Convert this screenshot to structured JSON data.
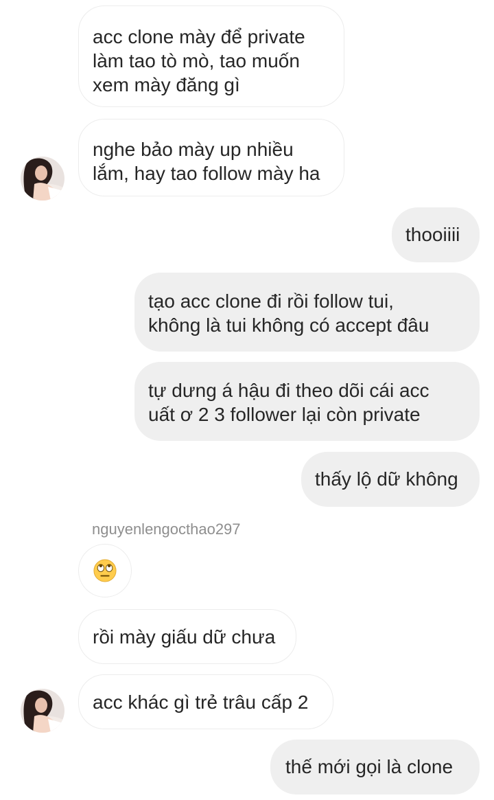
{
  "conversation": {
    "messages": [
      {
        "text": "acc clone mày để private\nlàm tao tò mò, tao muốn\nxem mày đăng gì"
      },
      {
        "text": "nghe bảo mày up nhiều\nlắm, hay tao follow mày ha"
      },
      {
        "text": "thooiiii"
      },
      {
        "text": "tạo acc clone đi rồi follow tui,\nkhông là tui không có accept đâu"
      },
      {
        "text": "tự dưng á hậu đi theo dõi cái acc\nuất ơ 2 3 follower lại còn private"
      },
      {
        "text": "thấy lộ dữ không"
      },
      {
        "text": "rồi mày giấu dữ chưa"
      },
      {
        "text": "acc khác gì trẻ trâu cấp 2"
      },
      {
        "text": "thế mới gọi là clone"
      }
    ],
    "sender_name": "nguyenlengocthao297",
    "emoji_reaction": "eye-roll-emoji"
  },
  "colors": {
    "received_bubble_bg": "#ffffff",
    "received_bubble_border": "#ececec",
    "sent_bubble_bg": "#efefef",
    "text": "#262626",
    "sender_name": "#8e8e8e",
    "emoji_face": "#ffcc4d"
  }
}
